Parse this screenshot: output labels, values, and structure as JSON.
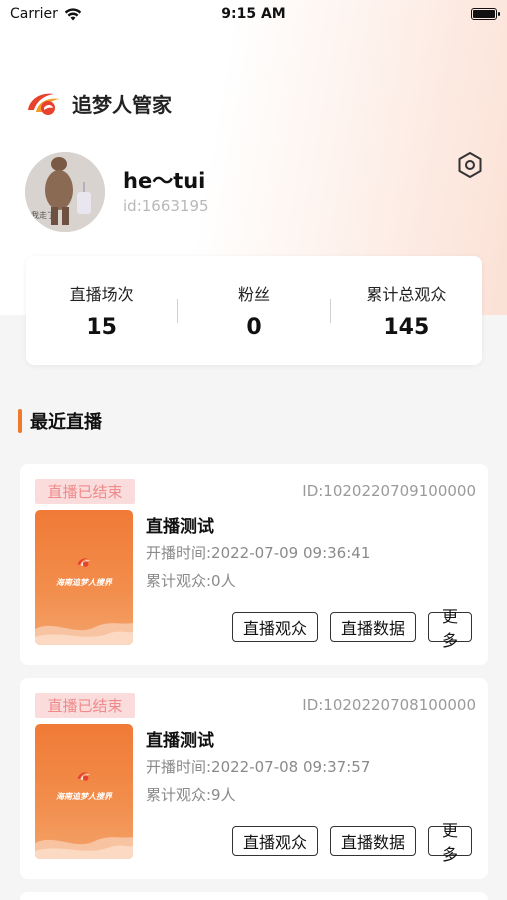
{
  "status_bar": {
    "carrier": "Carrier",
    "time": "9:15 AM"
  },
  "brand": {
    "title": "追梦人管家"
  },
  "profile": {
    "username": "he～tui",
    "user_id": "id:1663195",
    "avatar_caption": "我走了"
  },
  "stats": [
    {
      "label": "直播场次",
      "value": "15"
    },
    {
      "label": "粉丝",
      "value": "0"
    },
    {
      "label": "累计总观众",
      "value": "145"
    }
  ],
  "section": {
    "title": "最近直播"
  },
  "lives": [
    {
      "status": "直播已结束",
      "id": "ID:1020220709100000",
      "title": "直播测试",
      "start_time": "开播时间:2022-07-09 09:36:41",
      "viewers": "累计观众:0人",
      "cover_text": "海南追梦人搜界",
      "buttons": {
        "audience": "直播观众",
        "data": "直播数据",
        "more": "更多"
      }
    },
    {
      "status": "直播已结束",
      "id": "ID:1020220708100000",
      "title": "直播测试",
      "start_time": "开播时间:2022-07-08 09:37:57",
      "viewers": "累计观众:9人",
      "cover_text": "海南追梦人搜界",
      "buttons": {
        "audience": "直播观众",
        "data": "直播数据",
        "more": "更多"
      }
    }
  ],
  "colors": {
    "accent": "#ef7a2c",
    "badge_bg": "#fbdcdc",
    "badge_text": "#f08a8a"
  }
}
